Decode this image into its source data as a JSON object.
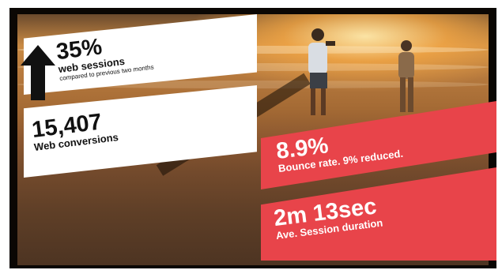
{
  "stats": {
    "web_sessions": {
      "value": "35%",
      "label": "web sessions",
      "sub": "compared to previous two months",
      "trend": "up"
    },
    "web_conversions": {
      "value": "15,407",
      "label": "Web conversions"
    },
    "bounce_rate": {
      "value": "8.9%",
      "label": "Bounce rate. 9% reduced."
    },
    "session_duration": {
      "value": "2m 13sec",
      "label": "Ave. Session duration"
    }
  },
  "colors": {
    "accent_red": "#e8444a",
    "panel_white": "#ffffff",
    "frame_dark": "#0b0704"
  },
  "icons": {
    "trend": "up-arrow-icon"
  }
}
